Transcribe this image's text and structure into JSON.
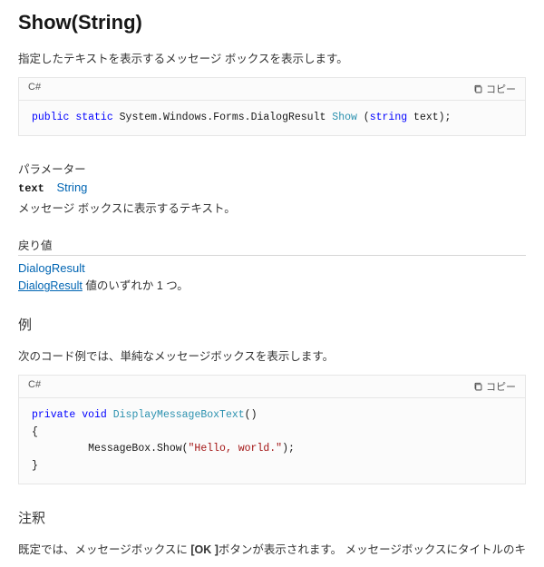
{
  "title": "Show(String)",
  "summary": "指定したテキストを表示するメッセージ ボックスを表示します。",
  "code1": {
    "lang": "C#",
    "copy": "コピー",
    "tokens": {
      "kw1": "public",
      "kw2": "static",
      "ns": " System.Windows.Forms.DialogResult ",
      "method": "Show",
      "paren_open": " (",
      "ptype": "string",
      "pname": " text);"
    }
  },
  "params": {
    "heading": "パラメーター",
    "name": "text",
    "type": "String",
    "desc": "メッセージ ボックスに表示するテキスト。"
  },
  "return": {
    "heading": "戻り値",
    "type_link": "DialogResult",
    "desc_link": "DialogResult",
    "desc_tail": " 値のいずれか 1 つ。"
  },
  "example": {
    "heading": "例",
    "desc": "次のコード例では、単純なメッセージボックスを表示します。",
    "lang": "C#",
    "copy": "コピー",
    "tokens": {
      "kw1": "private",
      "kw2": "void",
      "name": "DisplayMessageBoxText",
      "paren": "()",
      "open": "{",
      "call_pre": "         MessageBox.Show(",
      "str": "\"Hello, world.\"",
      "call_post": ");",
      "close": "}"
    }
  },
  "notes": {
    "heading": "注釈",
    "text_pre": "既定では、メッセージボックスに ",
    "bold": "[OK ]",
    "text_post": "ボタンが表示されます。 メッセージボックスにタイトルのキャプションが含まれていませ"
  }
}
